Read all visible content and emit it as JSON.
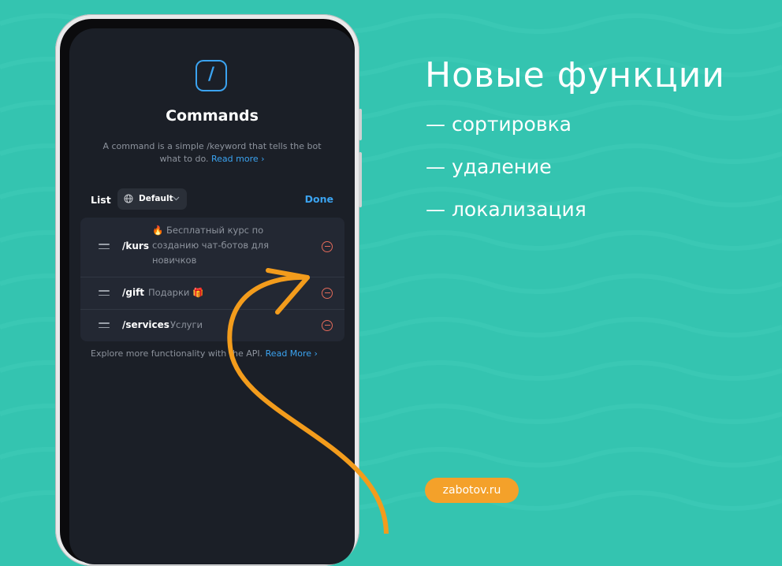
{
  "colors": {
    "background": "#34c4b0",
    "accent": "#3ba3f0",
    "delete": "#e26a5a",
    "arrow": "#f39c1c",
    "badge": "#f4a12a"
  },
  "app": {
    "icon_glyph": "/",
    "title": "Commands",
    "description": "A command is a simple /keyword that tells the bot what to do.",
    "read_more": "Read more ›",
    "list_label": "List",
    "language_select": "Default",
    "done": "Done",
    "commands": [
      {
        "command": "/kurs",
        "description": "🔥 Бесплатный курс по созданию чат-ботов для новичков"
      },
      {
        "command": "/gift",
        "description": "Подарки 🎁"
      },
      {
        "command": "/services",
        "description": "Услуги"
      }
    ],
    "footer_text": "Explore more functionality with the API.",
    "footer_link": "Read More ›"
  },
  "promo": {
    "headline": "Новые функции",
    "features": [
      "— сортировка",
      "— удаление",
      "— локализация"
    ],
    "site": "zabotov.ru"
  }
}
